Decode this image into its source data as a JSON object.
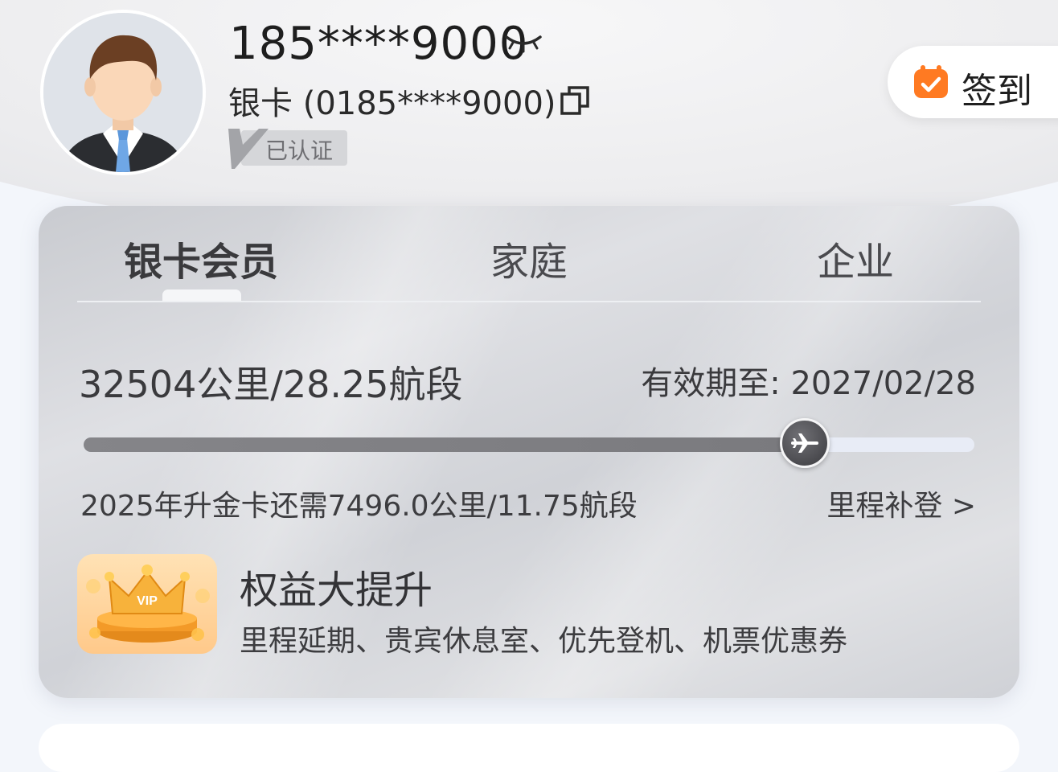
{
  "profile": {
    "phone_masked": "185****9000",
    "card_line": "银卡 (0185****9000)",
    "verified_label": "已认证"
  },
  "signin": {
    "label": "签到"
  },
  "member_card": {
    "tabs": [
      {
        "label": "银卡会员",
        "active": true
      },
      {
        "label": "家庭",
        "active": false
      },
      {
        "label": "企业",
        "active": false
      }
    ],
    "mileage_summary": "32504公里/28.25航段",
    "validity": "有效期至: 2027/02/28",
    "progress": {
      "fraction": 0.81
    },
    "upgrade_hint": "2025年升金卡还需7496.0公里/11.75航段",
    "supplement_link": "里程补登 >",
    "benefit": {
      "title": "权益大提升",
      "subtitle": "里程延期、贵宾休息室、优先登机、机票优惠券",
      "badge_text": "VIP"
    }
  },
  "colors": {
    "card_gray": "#d4d6da",
    "progress_fill": "#7d7d81",
    "progress_track": "#e8ecf6",
    "signin_icon": "#ff7a22",
    "vip_gold": "#f5a623"
  }
}
